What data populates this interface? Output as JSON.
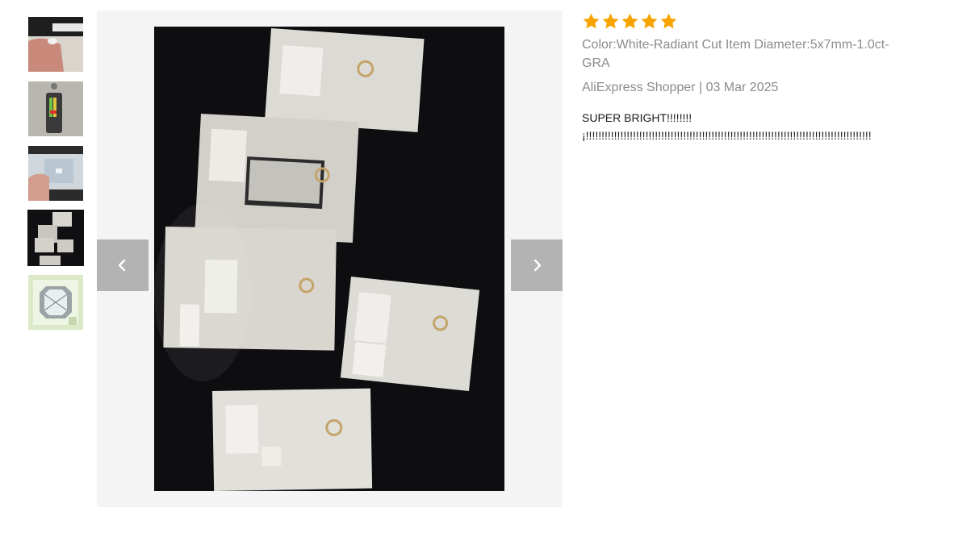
{
  "gallery": {
    "thumbnails": [
      {
        "name": "thumb-hand-holding-stone",
        "active": false
      },
      {
        "name": "thumb-diamond-tester",
        "active": false
      },
      {
        "name": "thumb-stone-in-bag",
        "active": false
      },
      {
        "name": "thumb-certificates",
        "active": true
      },
      {
        "name": "thumb-product-certificate",
        "active": false
      }
    ],
    "prev_icon": "chevron-left-icon",
    "next_icon": "chevron-right-icon",
    "button_color": "#b3b3b3"
  },
  "review": {
    "rating": 5,
    "star_color": "#f7a300",
    "sku": "Color:White-Radiant Cut Item Diameter:5x7mm-1.0ct-GRA",
    "meta": "AliExpress Shopper | 03 Mar 2025",
    "text": "SUPER BRIGHT!!!!!!!! ¡!!!!!!!!!!!!!!!!!!!!!!!!!!!!!!!!!!!!!!!!!!!!!!!!!!!!!!!!!!!!!!!!!!!!!!!!!!!!!!!!!!!!!!!!!!!"
  }
}
